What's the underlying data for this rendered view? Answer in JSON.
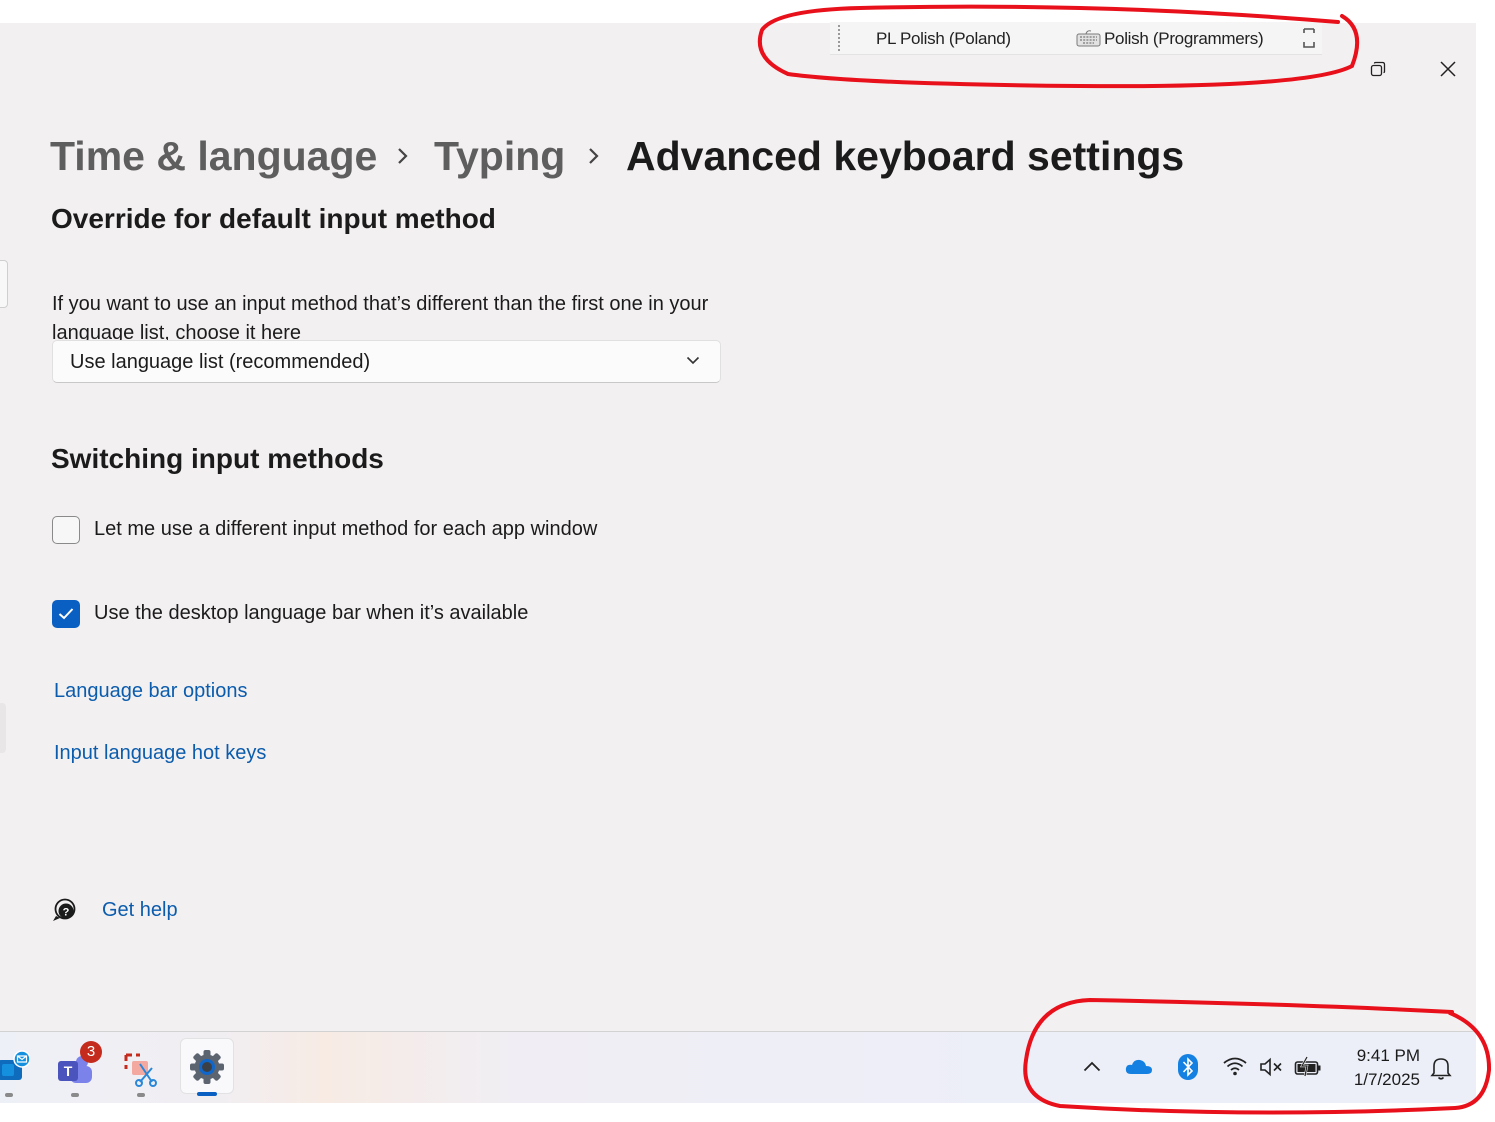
{
  "language_bar": {
    "language": "PL Polish (Poland)",
    "keyboard": "Polish (Programmers)"
  },
  "breadcrumb": {
    "items": [
      "Time & language",
      "Typing"
    ],
    "current": "Advanced keyboard settings"
  },
  "override": {
    "title": "Override for default input method",
    "description": "If you want to use an input method that’s different than the first one in your language list, choose it here",
    "dropdown_value": "Use language list (recommended)"
  },
  "switching": {
    "title": "Switching input methods",
    "options": [
      {
        "label": "Let me use a different input method for each app window",
        "checked": false
      },
      {
        "label": "Use the desktop language bar when it’s available",
        "checked": true
      }
    ]
  },
  "links": {
    "language_bar_options": "Language bar options",
    "input_language_hot_keys": "Input language hot keys",
    "get_help": "Get help"
  },
  "taskbar": {
    "teams_badge": "3",
    "time": "9:41 PM",
    "date": "1/7/2025"
  },
  "colors": {
    "accent": "#0a5fc2",
    "link": "#0b5cad",
    "annotation": "#e8101a"
  }
}
